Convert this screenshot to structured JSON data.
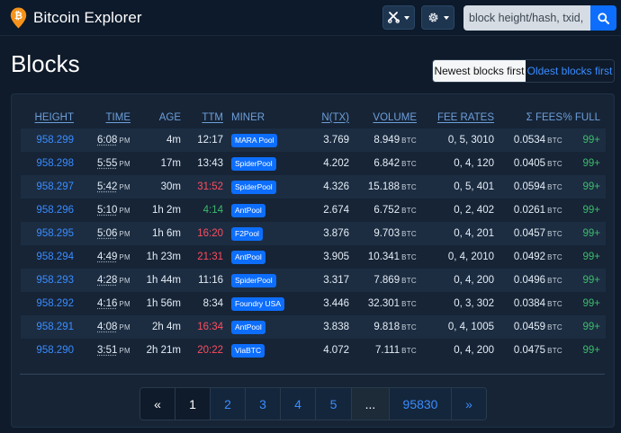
{
  "app": {
    "title": "Bitcoin Explorer"
  },
  "search": {
    "placeholder": "block height/hash, txid, address"
  },
  "page": {
    "title": "Blocks"
  },
  "sort": {
    "newest": "Newest blocks first",
    "oldest": "Oldest blocks first"
  },
  "colors": {
    "accent": "#0d6efd",
    "link": "#3a8cff",
    "positive": "#3dbb6b",
    "negative": "#ff4d5e",
    "logo": "#f7931a"
  },
  "columns": {
    "height": "HEIGHT",
    "time": "TIME",
    "age": "AGE",
    "ttm": "TTM",
    "miner": "MINER",
    "ntx": "N(TX)",
    "volume": "VOLUME",
    "fee_rates": "FEE RATES",
    "fees": "Σ FEES",
    "full": "% FULL"
  },
  "units": {
    "btc": "BTC"
  },
  "blocks": [
    {
      "height": "958.299",
      "time": "6:08",
      "ampm": "PM",
      "age": "4m",
      "ttm": "12:17",
      "ttm_status": "normal",
      "miner": "MARA Pool",
      "ntx": "3.769",
      "volume": "8.949",
      "fee_rates": "0, 5, 3010",
      "fees": "0.0534",
      "full": "99+"
    },
    {
      "height": "958.298",
      "time": "5:55",
      "ampm": "PM",
      "age": "17m",
      "ttm": "13:43",
      "ttm_status": "normal",
      "miner": "SpiderPool",
      "ntx": "4.202",
      "volume": "6.842",
      "fee_rates": "0, 4, 120",
      "fees": "0.0405",
      "full": "99+"
    },
    {
      "height": "958.297",
      "time": "5:42",
      "ampm": "PM",
      "age": "30m",
      "ttm": "31:52",
      "ttm_status": "slow",
      "miner": "SpiderPool",
      "ntx": "4.326",
      "volume": "15.188",
      "fee_rates": "0, 5, 401",
      "fees": "0.0594",
      "full": "99+"
    },
    {
      "height": "958.296",
      "time": "5:10",
      "ampm": "PM",
      "age": "1h 2m",
      "ttm": "4:14",
      "ttm_status": "fast",
      "miner": "AntPool",
      "ntx": "2.674",
      "volume": "6.752",
      "fee_rates": "0, 2, 402",
      "fees": "0.0261",
      "full": "99+"
    },
    {
      "height": "958.295",
      "time": "5:06",
      "ampm": "PM",
      "age": "1h 6m",
      "ttm": "16:20",
      "ttm_status": "slow",
      "miner": "F2Pool",
      "ntx": "3.876",
      "volume": "9.703",
      "fee_rates": "0, 4, 201",
      "fees": "0.0457",
      "full": "99+"
    },
    {
      "height": "958.294",
      "time": "4:49",
      "ampm": "PM",
      "age": "1h 23m",
      "ttm": "21:31",
      "ttm_status": "slow",
      "miner": "AntPool",
      "ntx": "3.905",
      "volume": "10.341",
      "fee_rates": "0, 4, 2010",
      "fees": "0.0492",
      "full": "99+"
    },
    {
      "height": "958.293",
      "time": "4:28",
      "ampm": "PM",
      "age": "1h 44m",
      "ttm": "11:16",
      "ttm_status": "normal",
      "miner": "SpiderPool",
      "ntx": "3.317",
      "volume": "7.869",
      "fee_rates": "0, 4, 200",
      "fees": "0.0496",
      "full": "99+"
    },
    {
      "height": "958.292",
      "time": "4:16",
      "ampm": "PM",
      "age": "1h 56m",
      "ttm": "8:34",
      "ttm_status": "normal",
      "miner": "Foundry USA",
      "ntx": "3.446",
      "volume": "32.301",
      "fee_rates": "0, 3, 302",
      "fees": "0.0384",
      "full": "99+"
    },
    {
      "height": "958.291",
      "time": "4:08",
      "ampm": "PM",
      "age": "2h 4m",
      "ttm": "16:34",
      "ttm_status": "slow",
      "miner": "AntPool",
      "ntx": "3.838",
      "volume": "9.818",
      "fee_rates": "0, 4, 1005",
      "fees": "0.0459",
      "full": "99+"
    },
    {
      "height": "958.290",
      "time": "3:51",
      "ampm": "PM",
      "age": "2h 21m",
      "ttm": "20:22",
      "ttm_status": "slow",
      "miner": "ViaBTC",
      "ntx": "4.072",
      "volume": "7.111",
      "fee_rates": "0, 4, 200",
      "fees": "0.0475",
      "full": "99+"
    }
  ],
  "pagination": {
    "prev": "«",
    "pages": [
      "1",
      "2",
      "3",
      "4",
      "5"
    ],
    "ellipsis": "...",
    "last": "95830",
    "next": "»",
    "current": "1"
  },
  "icons": {
    "logo": "bitcoin-pin-icon",
    "tools": "tools-icon",
    "settings": "gear-icon",
    "search": "search-icon"
  }
}
